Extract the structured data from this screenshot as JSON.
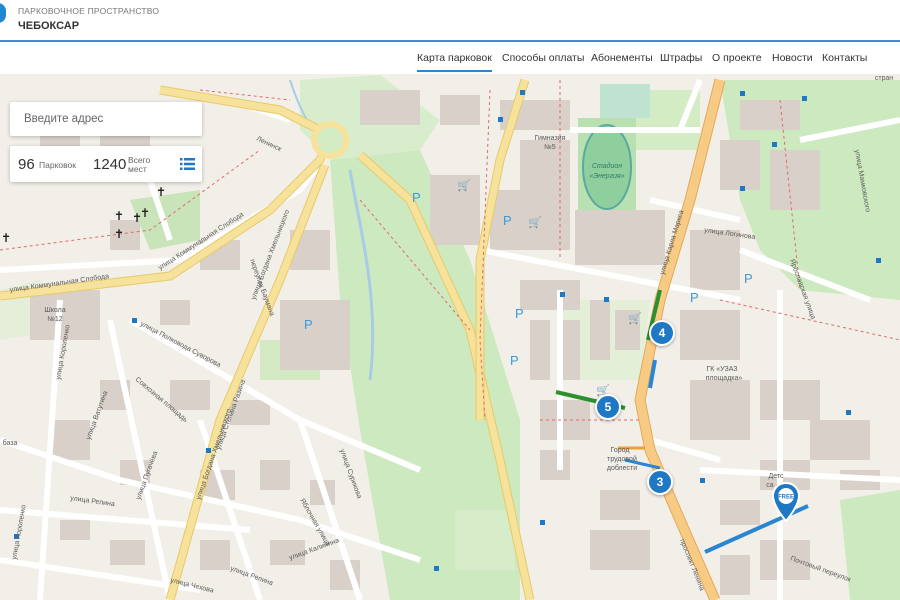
{
  "header": {
    "subtitle": "ПАРКОВОЧНОЕ ПРОСТРАНСТВО",
    "title": "ЧЕБОКСАР"
  },
  "nav": {
    "items": [
      {
        "label": "Карта парковок"
      },
      {
        "label": "Способы оплаты"
      },
      {
        "label": "Абонементы"
      },
      {
        "label": "Штрафы"
      },
      {
        "label": "О проекте"
      },
      {
        "label": "Новости"
      },
      {
        "label": "Контакты"
      }
    ]
  },
  "search": {
    "placeholder": "Введите адрес"
  },
  "stats": {
    "parkings_count": "96",
    "parkings_label": "Парковок",
    "places_count": "1240",
    "places_label_1": "Всего",
    "places_label_2": "мест"
  },
  "markers": [
    {
      "label": "4"
    },
    {
      "label": "5"
    },
    {
      "label": "3"
    }
  ],
  "free_pin": {
    "label": "FREE"
  },
  "map_labels": {
    "street_kommunalnaya": "улица Коммунальная Слобода",
    "street_kommunalnaya2": "улица Коммунальная Слобода",
    "street_khmelnitskogo": "улица Богдана Хмельницкого",
    "street_khmelnitskogo2": "улица Богдана Хмельницкого",
    "street_marksa": "улица Карла Маркса",
    "street_loginova": "улица Логинова",
    "street_yaroslavskaya": "Ярославская улица",
    "street_mamkovskogo": "улица Мамковского",
    "street_suvorova": "улица Полковода Суворова",
    "street_sovhoznaya": "Совхозная площадь",
    "street_razina": "улица Степана Разина",
    "street_vatutina": "улица Ватутина",
    "street_repina": "улица Репина",
    "street_repina2": "улица Репина",
    "street_chekhova": "улица Чехова",
    "street_surikova": "улица Сурикова",
    "street_korolenko": "улица Короленко",
    "street_korolenko2": "улица Короленко",
    "street_pugacheva": "улица Пугачёва",
    "street_kalinina": "улица Калинина",
    "street_yablochnaya": "Яблочная улица",
    "street_baumana": "переулок Баумана",
    "street_leninsk": "Ленинск",
    "prospekt_lenina": "проспект Ленина",
    "street_pochtovy": "Почтовый переулок",
    "gymnasium": "Гимназия",
    "gymnasium_num": "№5",
    "stadium": "Стадион",
    "stadium_name": "«Энергия»",
    "school": "Школа",
    "school_num": "№12",
    "square_gk": "ГК «УЗАЗ",
    "square_name": "площадка»",
    "city_1": "Город",
    "city_2": "трудовой",
    "city_3": "доблести",
    "kids": "Детс",
    "kids2": "са",
    "stran": "стран",
    "baza": "база",
    "p": "P"
  },
  "colors": {
    "accent": "#2a86d1",
    "marker": "#1f78c4",
    "park": "#cde9bf",
    "road_major": "#f5dd8c",
    "road_primary": "#f6c983",
    "building": "#d9d0c9",
    "parking_green": "#3a9a3a",
    "parking_blue": "#2a86d1"
  }
}
